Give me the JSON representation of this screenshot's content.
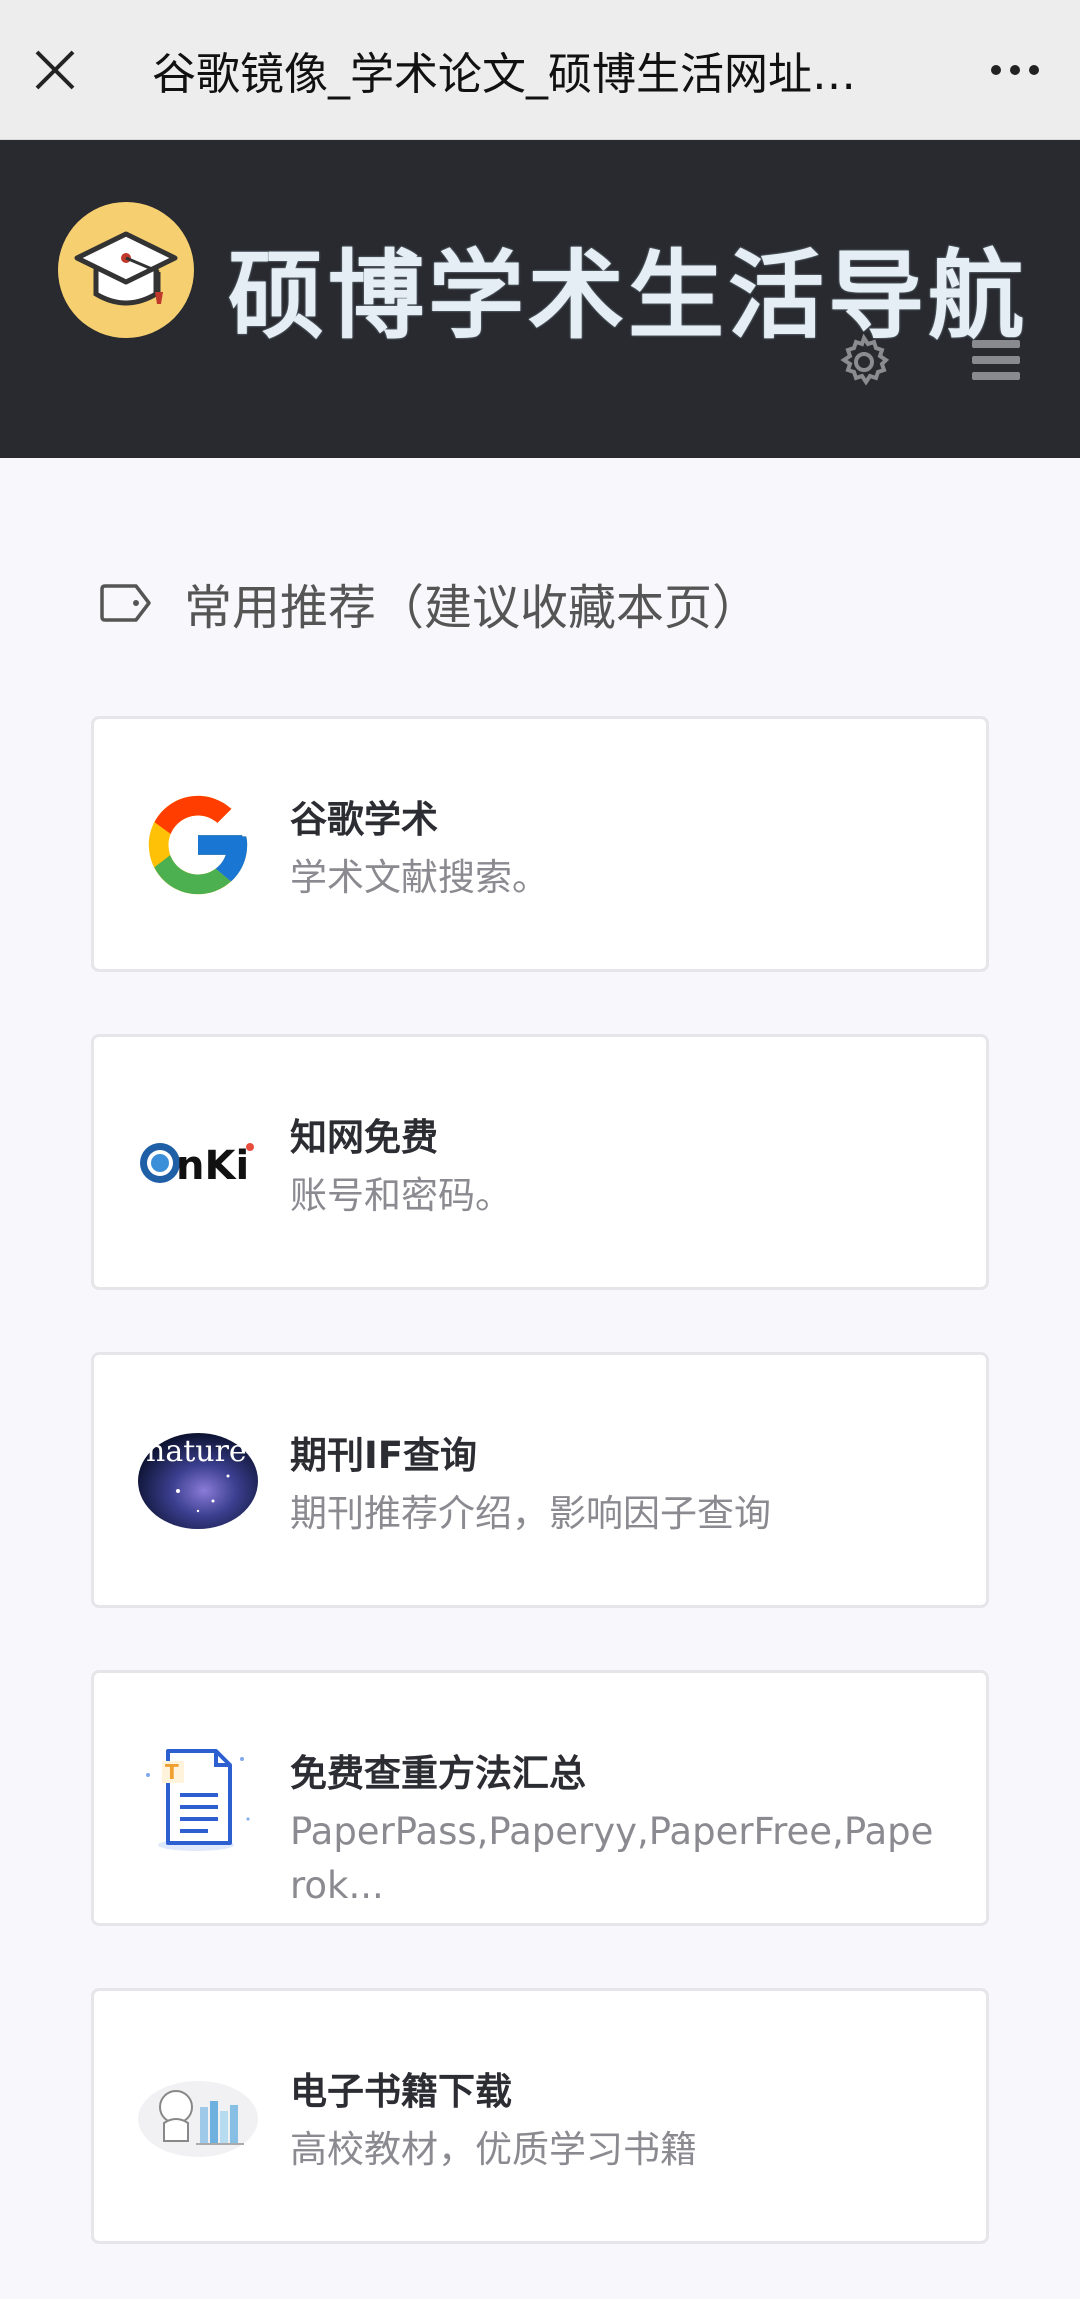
{
  "browser": {
    "title": "谷歌镜像_学术论文_硕博生活网址…"
  },
  "header": {
    "brand": "硕博学术生活导航"
  },
  "section": {
    "title": "常用推荐（建议收藏本页）"
  },
  "cards": [
    {
      "name": "谷歌学术",
      "desc": "学术文献搜索。",
      "icon": "google-logo"
    },
    {
      "name": "知网免费",
      "desc": "账号和密码。",
      "icon": "cnki-logo"
    },
    {
      "name": "期刊IF查询",
      "desc": "期刊推荐介绍，影响因子查询",
      "icon": "nature-logo"
    },
    {
      "name": "免费查重方法汇总",
      "desc": "PaperPass,Paperyy,PaperFree,Paperok...",
      "icon": "document-icon"
    },
    {
      "name": "电子书籍下载",
      "desc": "高校教材，优质学习书籍",
      "icon": "books-icon"
    }
  ],
  "colors": {
    "header_bg": "#282a2f",
    "badge": "#f6cf70",
    "topbar_bg": "#ededed",
    "page_bg": "#f8f7fb"
  }
}
